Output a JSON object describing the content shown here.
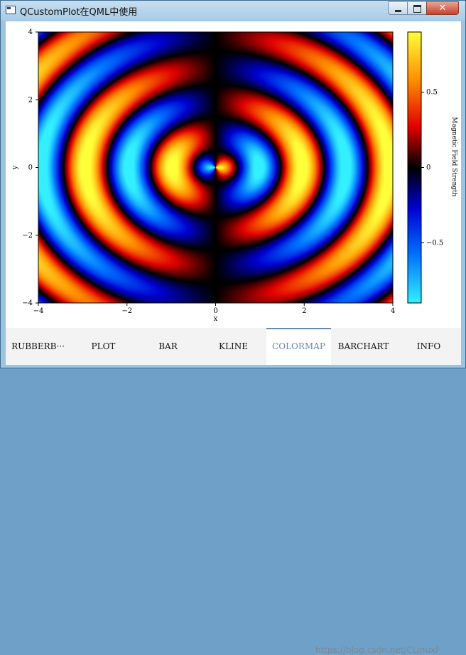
{
  "window": {
    "title": "QCustomPlot在QML中使用",
    "close_glyph": "✕"
  },
  "chart_data": {
    "type": "heatmap",
    "title": "",
    "xlabel": "x",
    "ylabel": "y",
    "xlim": [
      -4,
      4
    ],
    "ylim": [
      -4,
      4
    ],
    "x_ticks": [
      -4,
      -2,
      0,
      2,
      4
    ],
    "y_ticks": [
      4,
      2,
      0,
      -2,
      -4
    ],
    "colorbar": {
      "label": "Magnetic Field Strength",
      "range": [
        -0.9,
        0.9
      ],
      "ticks": [
        0.5,
        0,
        -0.5
      ],
      "tick_labels": [
        "0.5",
        "0",
        "−0.5"
      ],
      "gradient": [
        "#33f0ff",
        "#0070ff",
        "#0000d0",
        "#000000",
        "#e00000",
        "#ff8c00",
        "#ffff3a"
      ]
    },
    "field": "dipole-like radial waves: value = cos(3·r)·x/r-style pattern, alternating rings",
    "grid": false
  },
  "tabs": [
    {
      "label": "RUBBERB···",
      "active": false
    },
    {
      "label": "PLOT",
      "active": false
    },
    {
      "label": "BAR",
      "active": false
    },
    {
      "label": "KLINE",
      "active": false
    },
    {
      "label": "COLORMAP",
      "active": true
    },
    {
      "label": "BARCHART",
      "active": false
    },
    {
      "label": "INFO",
      "active": false
    }
  ],
  "watermark": "https://blog.csdn.net/CLinuxF"
}
